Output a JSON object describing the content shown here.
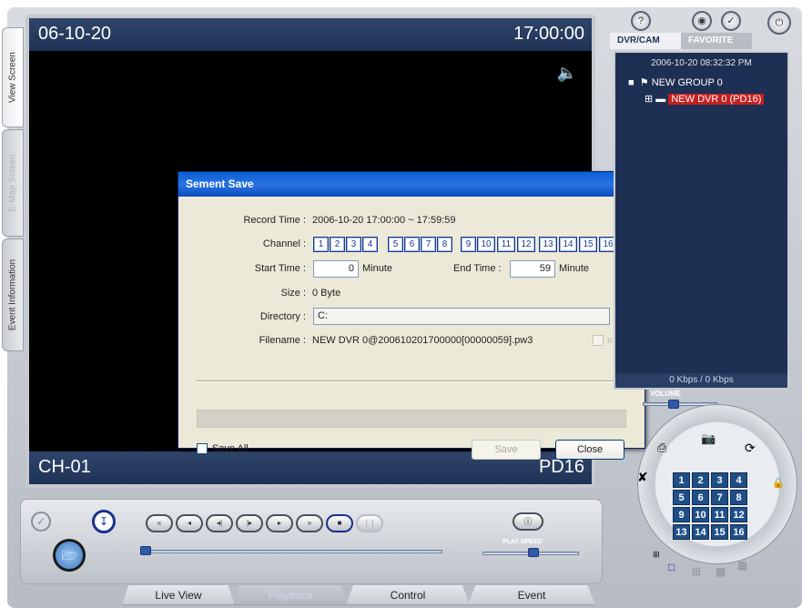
{
  "left_tabs": {
    "view_screen": "View Screen",
    "emap_screen": "E-Map Screen",
    "event_information": "Event Information"
  },
  "screen": {
    "date": "06-10-20",
    "time": "17:00:00",
    "channel_label": "CH-01",
    "device_label": "PD16"
  },
  "dialog": {
    "title": "Sement Save",
    "record_time_label": "Record Time :",
    "record_time_value": "2006-10-20  17:00:00  ~  17:59:59",
    "channel_label": "Channel :",
    "channels": [
      "1",
      "2",
      "3",
      "4",
      "5",
      "6",
      "7",
      "8",
      "9",
      "10",
      "11",
      "12",
      "13",
      "14",
      "15",
      "16"
    ],
    "start_time_label": "Start Time :",
    "start_time_value": "0",
    "start_unit": "Minute",
    "end_time_label": "End Time :",
    "end_time_value": "59",
    "end_unit": "Minute",
    "size_label": "Size :",
    "size_value": "0 Byte",
    "directory_label": "Directory :",
    "directory_value": "C:",
    "browse_label": "...",
    "filename_label": "Filename :",
    "filename_value": "NEW DVR 0@200610201700000[00000059].pw3",
    "exe_label": "exe",
    "save_all_label": "Save All",
    "save_button": "Save",
    "close_button": "Close"
  },
  "right_panel": {
    "tab_dvrcam": "DVR/CAM",
    "tab_favorite": "FAVORITE",
    "timestamp": "2006-10-20 08:32:32 PM",
    "group_node": "NEW GROUP 0",
    "dvr_node": "NEW DVR 0 (PD16)",
    "bandwidth": "0 Kbps / 0 Kbps",
    "volume_label": "VOLUME",
    "grid_numbers": [
      "1",
      "2",
      "3",
      "4",
      "5",
      "6",
      "7",
      "8",
      "9",
      "10",
      "11",
      "12",
      "13",
      "14",
      "15",
      "16"
    ]
  },
  "bottom_bar": {
    "play_speed_label": "PLAY SPEED",
    "playback_buttons": [
      "fast-rewind",
      "rewind",
      "step-back",
      "step-forward",
      "play",
      "fast-forward",
      "stop",
      "pause"
    ]
  },
  "bottom_tabs": [
    "Live View",
    "Playback",
    "Control",
    "Event"
  ],
  "colors": {
    "title_bar": "#1f3256",
    "dialog_title": "#0a5fd8",
    "selected_node": "#c62020"
  }
}
